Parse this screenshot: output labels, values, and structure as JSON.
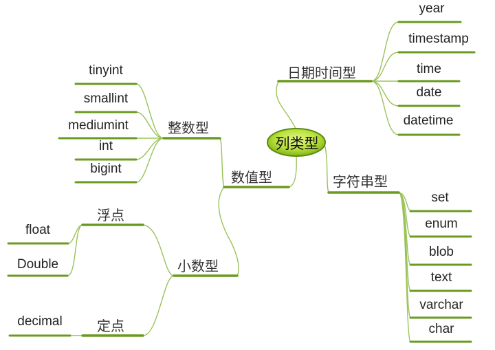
{
  "colors": {
    "underline": "#6a9a1f",
    "connector": "#9bc25a",
    "root_fill_outer": "#7fb21a",
    "root_fill_inner": "#d8f27a",
    "root_stroke": "#5a8a10"
  },
  "mindmap": {
    "root": "列类型",
    "branches": {
      "datetime": {
        "label": "日期时间型",
        "children": [
          "year",
          "timestamp",
          "time",
          "date",
          "datetime"
        ]
      },
      "string": {
        "label": "字符串型",
        "children": [
          "set",
          "enum",
          "blob",
          "text",
          "varchar",
          "char"
        ]
      },
      "numeric": {
        "label": "数值型",
        "integer": {
          "label": "整数型",
          "children": [
            "tinyint",
            "smallint",
            "mediumint",
            "int",
            "bigint"
          ]
        },
        "decimal_type": {
          "label": "小数型",
          "floating": {
            "label": "浮点",
            "children": [
              "float",
              "Double"
            ]
          },
          "fixed": {
            "label": "定点",
            "children": [
              "decimal"
            ]
          }
        }
      }
    }
  }
}
